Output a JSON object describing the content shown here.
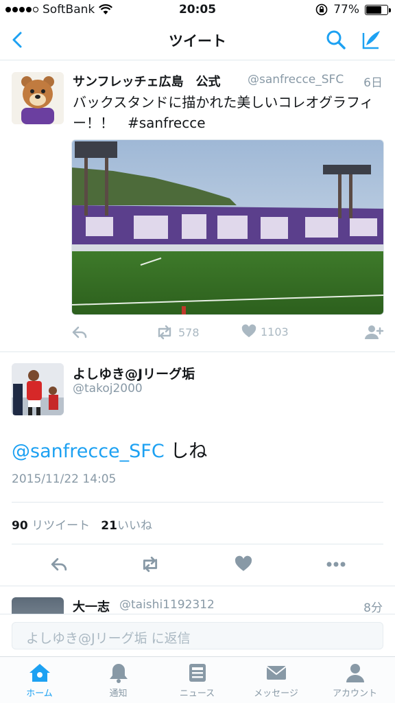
{
  "status_bar": {
    "carrier": "SoftBank",
    "time": "20:05",
    "battery_percent": "77%",
    "battery_level": 0.77
  },
  "nav": {
    "title": "ツイート"
  },
  "tweet_context": {
    "name": "サンフレッチェ広島　公式",
    "handle": "@sanfrecce_SFC",
    "time": "6日",
    "text": "バックスタンドに描かれた美しいコレオグラフィー！！　#sanfrecce",
    "retweets": "578",
    "likes": "1103"
  },
  "main_tweet": {
    "name": "よしゆき@Jリーグ垢",
    "handle": "@takoj2000",
    "mention": "@sanfrecce_SFC",
    "text_rest": "しね",
    "date": "2015/11/22 14:05",
    "retweet_count": "90",
    "retweet_label": "リツイート",
    "like_count": "21",
    "like_label": "いいね"
  },
  "reply_preview": {
    "name": "大一志",
    "handle": "@taishi1192312",
    "time": "8分"
  },
  "reply_bar": {
    "placeholder": "よしゆき@Jリーグ垢 に返信"
  },
  "tabs": [
    {
      "label": "ホーム",
      "icon": "home-icon",
      "active": true
    },
    {
      "label": "通知",
      "icon": "bell-icon",
      "active": false
    },
    {
      "label": "ニュース",
      "icon": "news-icon",
      "active": false
    },
    {
      "label": "メッセージ",
      "icon": "envelope-icon",
      "active": false
    },
    {
      "label": "アカウント",
      "icon": "person-icon",
      "active": false
    }
  ],
  "colors": {
    "accent": "#1da1f2",
    "muted": "#8899a6",
    "icon_muted": "#aab8c2"
  }
}
